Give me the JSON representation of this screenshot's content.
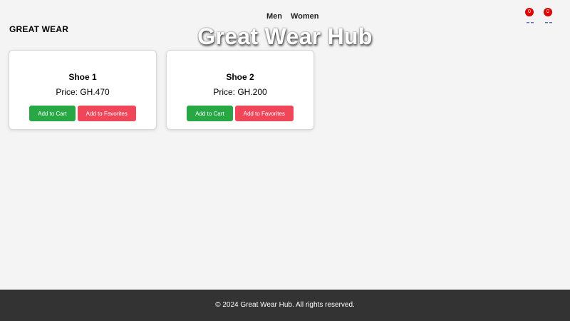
{
  "header": {
    "brand": "GREAT WEAR",
    "title": "Great Wear Hub",
    "nav": [
      {
        "label": "Men"
      },
      {
        "label": "Women"
      }
    ],
    "icons": [
      {
        "name": "cart-icon",
        "count": "0"
      },
      {
        "name": "favorites-icon",
        "count": "0"
      }
    ]
  },
  "products": [
    {
      "name": "Shoe 1",
      "price": "Price: GH.470",
      "add_to_cart": "Add to Cart",
      "add_to_favorites": "Add to Favorites"
    },
    {
      "name": "Shoe 2",
      "price": "Price: GH.200",
      "add_to_cart": "Add to Cart",
      "add_to_favorites": "Add to Favorites"
    }
  ],
  "footer": {
    "text": "© 2024 Great Wear Hub. All rights reserved."
  },
  "colors": {
    "background": "#f4f4f4",
    "cart_button": "#28a745",
    "favorites_button": "#f0465a",
    "badge": "#e00000",
    "footer_bg": "#333333"
  }
}
